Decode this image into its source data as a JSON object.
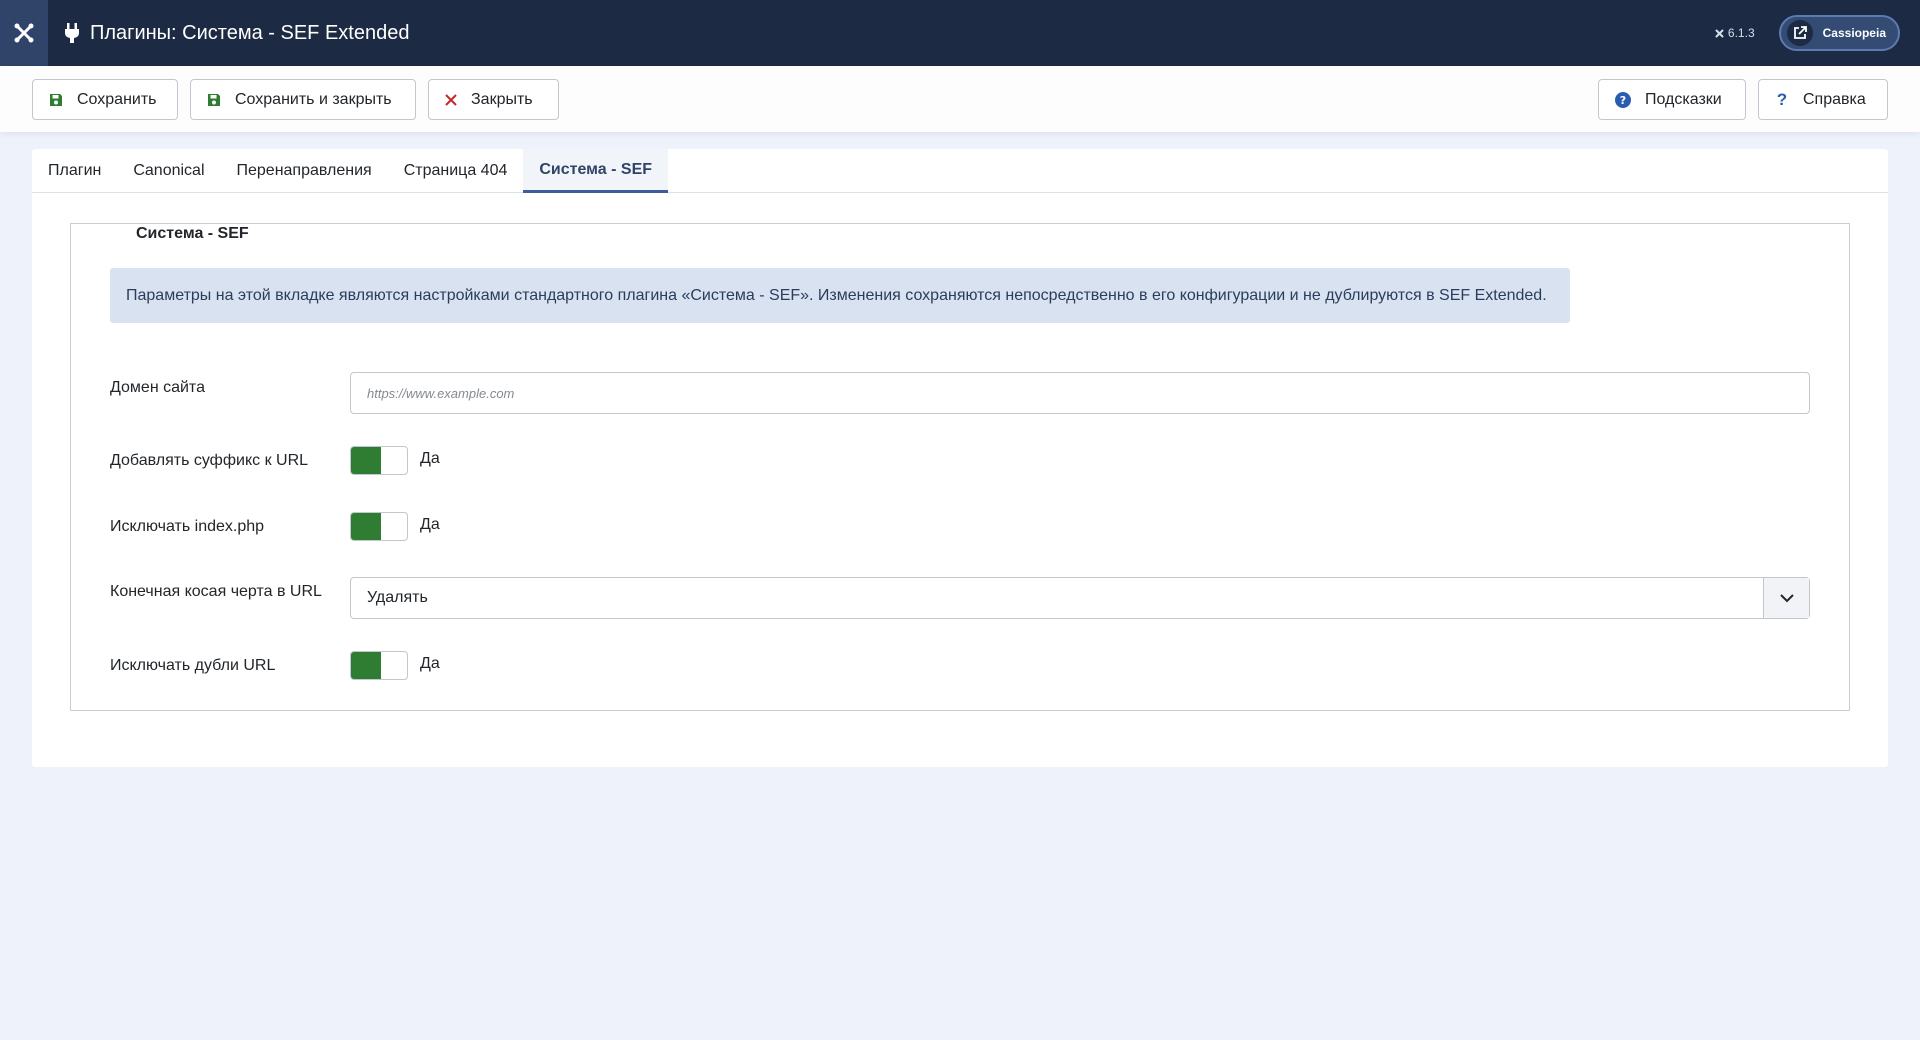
{
  "header": {
    "title": "Плагины: Система - SEF Extended",
    "version": "6.1.3",
    "site_button": "Cassiopeia"
  },
  "toolbar": {
    "save": "Сохранить",
    "save_close": "Сохранить и закрыть",
    "close": "Закрыть",
    "hints": "Подсказки",
    "help": "Справка"
  },
  "tabs": [
    {
      "label": "Плагин"
    },
    {
      "label": "Canonical"
    },
    {
      "label": "Перенаправления"
    },
    {
      "label": "Страница 404"
    },
    {
      "label": "Система - SEF",
      "active": true
    }
  ],
  "panel": {
    "legend": "Система - SEF",
    "info": "Параметры на этой вкладке являются настройками стандартного плагина «Система - SEF». Изменения сохраняются непосредственно в его конфигурации и не дублируются в SEF Extended.",
    "fields": {
      "domain": {
        "label": "Домен сайта",
        "placeholder": "https://www.example.com"
      },
      "suffix": {
        "label": "Добавлять суффикс к URL",
        "value": "Да"
      },
      "index_php": {
        "label": "Исключать index.php",
        "value": "Да"
      },
      "trailing_slash": {
        "label": "Конечная косая черта в URL",
        "value": "Удалять"
      },
      "duplicates": {
        "label": "Исключать дубли URL",
        "value": "Да"
      }
    }
  },
  "colors": {
    "header_bg": "#1c2a44",
    "accent": "#3e5c9a",
    "switch_on": "#2e7d32",
    "save_icon": "#2e7d32",
    "close_icon": "#c62828",
    "help_icon": "#2a5db0"
  }
}
